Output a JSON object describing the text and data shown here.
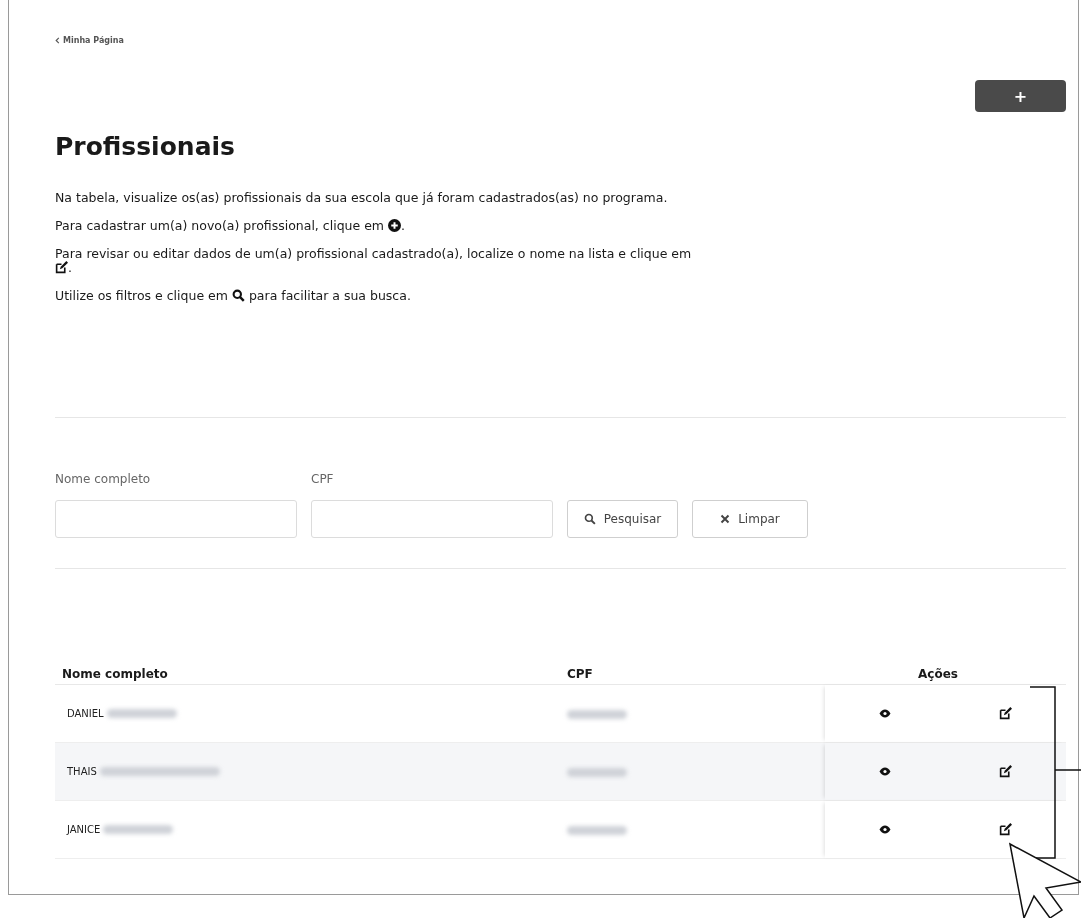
{
  "back_link": {
    "label": "Minha Página"
  },
  "add_button": {
    "label": "+"
  },
  "title": "Profissionais",
  "instructions": [
    {
      "text": "Na tabela, visualize os(as) profissionais da sua escola que já foram cadastrados(as) no programa."
    },
    {
      "text": "Para cadastrar um(a) novo(a) profissional, clique em",
      "kind": "plus",
      "after": "."
    },
    {
      "text": "Para revisar ou editar dados de um(a) profissional cadastrado(a), localize o nome na lista e clique em",
      "kind": "edit",
      "after": "."
    },
    {
      "text": "Utilize os filtros e clique em",
      "kind": "search",
      "after": "para facilitar a sua busca."
    }
  ],
  "filters": [
    {
      "label": "Nome completo"
    },
    {
      "label": "CPF"
    }
  ],
  "buttons": [
    {
      "kind": "search",
      "label": "Pesquisar"
    },
    {
      "kind": "clear",
      "label": "Limpar"
    }
  ],
  "table": {
    "columns": [
      "Nome completo",
      "CPF",
      "Ações"
    ],
    "rows": [
      {
        "name": "DANIEL"
      },
      {
        "name": "THAIS"
      },
      {
        "name": "JANICE"
      }
    ]
  }
}
